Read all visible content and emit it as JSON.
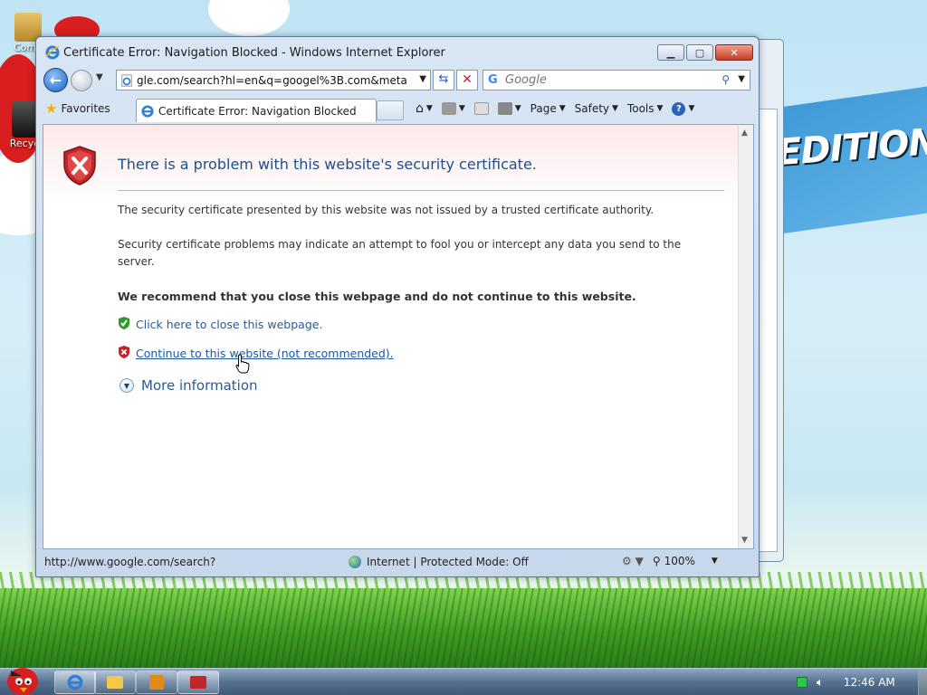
{
  "desktop": {
    "edition_text": "EDITION",
    "icons": [
      {
        "label": "Comp"
      },
      {
        "label": "Recyc"
      }
    ]
  },
  "window": {
    "title": "Certificate Error: Navigation Blocked - Windows Internet Explorer",
    "address": "gle.com/search?hl=en&q=googel%3B.com&meta=",
    "search_placeholder": "Google",
    "tab_title": "Certificate Error: Navigation Blocked",
    "favorites_label": "Favorites",
    "commands": {
      "page": "Page",
      "safety": "Safety",
      "tools": "Tools"
    }
  },
  "content": {
    "heading": "There is a problem with this website's security certificate.",
    "paragraph1": "The security certificate presented by this website was not issued by a trusted certificate authority.",
    "paragraph2": "Security certificate problems may indicate an attempt to fool you or intercept any data you send to the server.",
    "recommendation": "We recommend that you close this webpage and do not continue to this website.",
    "close_link": "Click here to close this webpage.",
    "continue_link": "Continue to this website (not recommended).",
    "more_info": "More information"
  },
  "statusbar": {
    "url": "http://www.google.com/search?",
    "zone": "Internet | Protected Mode: Off",
    "zoom": "100%"
  },
  "taskbar": {
    "clock": "12:46 AM"
  },
  "colors": {
    "accent_blue": "#1f4f86",
    "link_blue": "#1f56a0",
    "error_red": "#c0262a",
    "safe_green": "#2e9a2e"
  }
}
